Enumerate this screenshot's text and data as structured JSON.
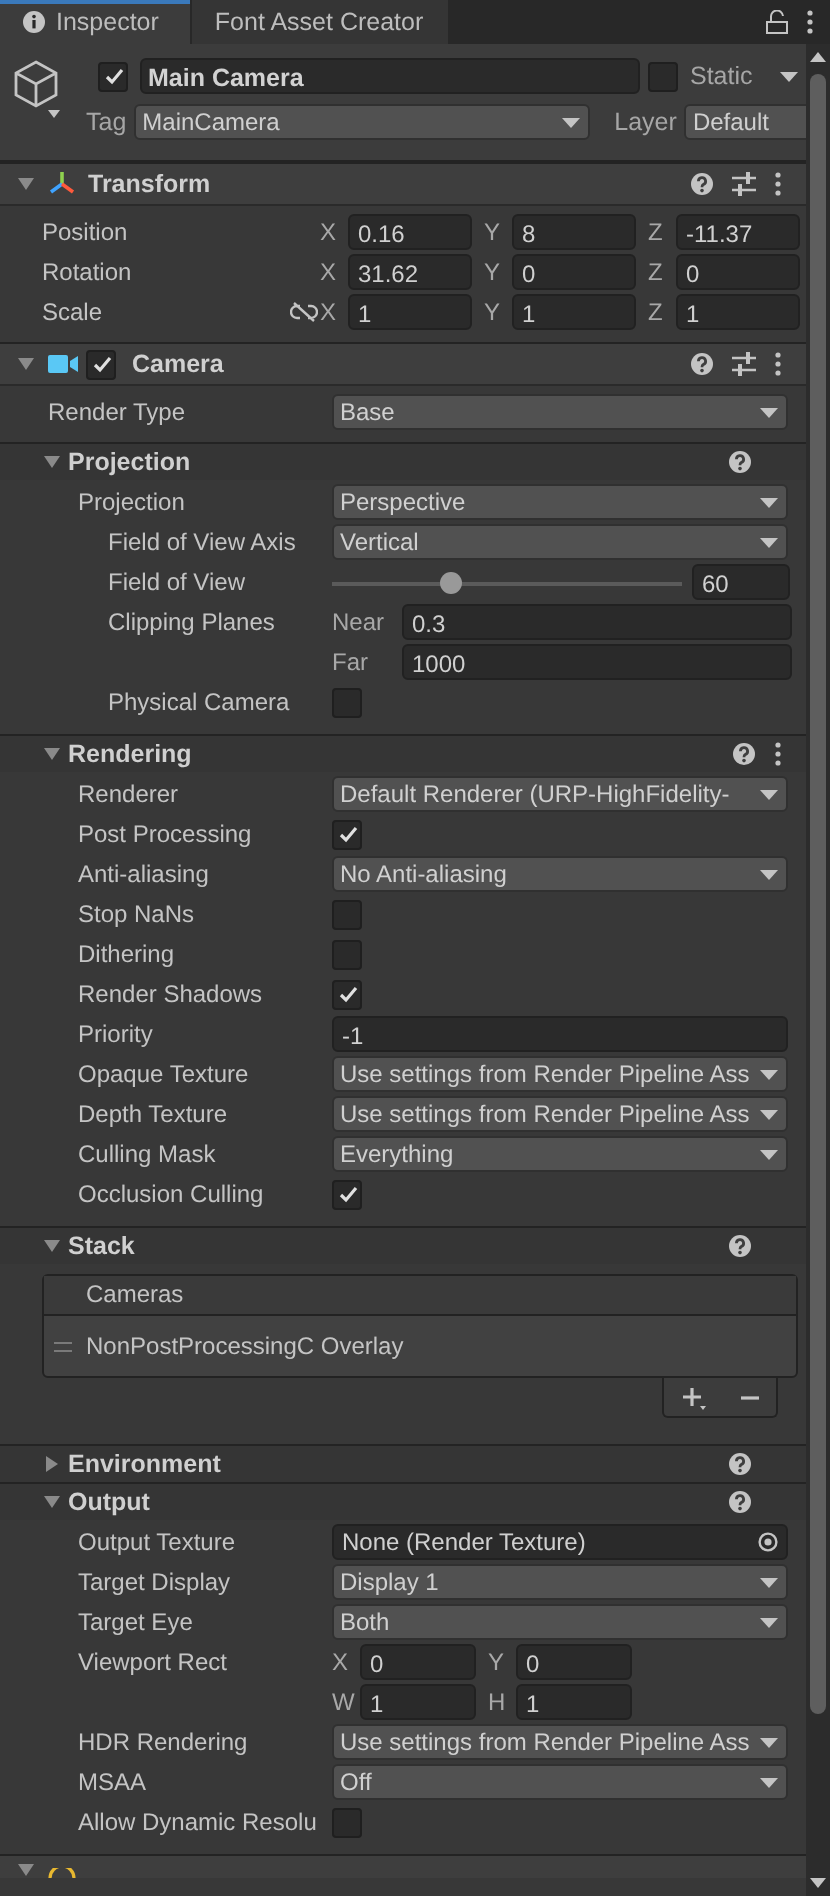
{
  "tabs": [
    {
      "label": "Inspector",
      "selected": true
    },
    {
      "label": "Font Asset Creator",
      "selected": false
    }
  ],
  "game_object": {
    "active": true,
    "name": "Main Camera",
    "static": false,
    "static_label": "Static",
    "tag_label": "Tag",
    "tag": "MainCamera",
    "layer_label": "Layer",
    "layer": "Default"
  },
  "components": [
    {
      "kind": "transform",
      "title": "Transform",
      "expanded": true,
      "help_button": true,
      "presets_button": true,
      "menu_button": true,
      "rows": [
        {
          "label": "Position",
          "kind": "vector",
          "fields": [
            {
              "axis": "X",
              "value": "0.16"
            },
            {
              "axis": "Y",
              "value": "8"
            },
            {
              "axis": "Z",
              "value": "-11.37"
            }
          ]
        },
        {
          "label": "Rotation",
          "kind": "vector",
          "fields": [
            {
              "axis": "X",
              "value": "31.62"
            },
            {
              "axis": "Y",
              "value": "0"
            },
            {
              "axis": "Z",
              "value": "0"
            }
          ]
        },
        {
          "label": "Scale",
          "kind": "vector",
          "proportions_linked": false,
          "fields": [
            {
              "axis": "X",
              "value": "1"
            },
            {
              "axis": "Y",
              "value": "1"
            },
            {
              "axis": "Z",
              "value": "1"
            }
          ]
        }
      ]
    },
    {
      "kind": "camera",
      "title": "Camera",
      "enabled": true,
      "expanded": true,
      "help_button": true,
      "presets_button": true,
      "menu_button": true,
      "rows": [
        {
          "label": "Render Type",
          "kind": "dropdown",
          "value": "Base"
        }
      ],
      "sections": [
        {
          "title": "Projection",
          "expanded": true,
          "help_button": true,
          "menu_button": false,
          "rows": [
            {
              "label": "Projection",
              "kind": "dropdown",
              "value": "Perspective",
              "children": [
                {
                  "label": "Field of View Axis",
                  "kind": "dropdown",
                  "value": "Vertical"
                },
                {
                  "label": "Field of View",
                  "kind": "slider",
                  "level": 0.335,
                  "value": "60"
                },
                {
                  "label": "Clipping Planes",
                  "kind": "pair",
                  "fields": [
                    {
                      "axis": "Near",
                      "value": "0.3"
                    },
                    {
                      "axis": "Far",
                      "value": "1000"
                    }
                  ]
                },
                {
                  "label": "Physical Camera",
                  "kind": "toggle",
                  "checked": false
                }
              ]
            }
          ]
        },
        {
          "title": "Rendering",
          "expanded": true,
          "help_button": true,
          "menu_button": true,
          "rows": [
            {
              "label": "Renderer",
              "kind": "dropdown",
              "value": "Default Renderer (URP-HighFidelity-"
            },
            {
              "label": "Post Processing",
              "kind": "toggle",
              "checked": true
            },
            {
              "label": "Anti-aliasing",
              "kind": "dropdown",
              "value": "No Anti-aliasing"
            },
            {
              "label": "Stop NaNs",
              "kind": "toggle",
              "checked": false
            },
            {
              "label": "Dithering",
              "kind": "toggle",
              "checked": false
            },
            {
              "label": "Render Shadows",
              "kind": "toggle",
              "checked": true
            },
            {
              "label": "Priority",
              "kind": "field",
              "value": "-1"
            },
            {
              "label": "Opaque Texture",
              "kind": "dropdown",
              "value": "Use settings from Render Pipeline Ass"
            },
            {
              "label": "Depth Texture",
              "kind": "dropdown",
              "value": "Use settings from Render Pipeline Ass"
            },
            {
              "label": "Culling Mask",
              "kind": "dropdown",
              "value": "Everything"
            },
            {
              "label": "Occlusion Culling",
              "kind": "toggle",
              "checked": true
            }
          ]
        },
        {
          "title": "Stack",
          "expanded": true,
          "help_button": true,
          "menu_button": false,
          "list": {
            "header": "Cameras",
            "items": [
              {
                "label": "NonPostProcessingC Overlay"
              }
            ]
          }
        },
        {
          "title": "Environment",
          "expanded": false,
          "help_button": true,
          "menu_button": false
        },
        {
          "title": "Output",
          "expanded": true,
          "help_button": true,
          "menu_button": false,
          "rows": [
            {
              "label": "Output Texture",
              "kind": "object",
              "value": "None (Render Texture)"
            },
            {
              "label": "Target Display",
              "kind": "dropdown",
              "value": "Display 1"
            },
            {
              "label": "Target Eye",
              "kind": "dropdown",
              "value": "Both"
            },
            {
              "label": "Viewport Rect",
              "kind": "rect",
              "fields": [
                {
                  "axis": "X",
                  "value": "0"
                },
                {
                  "axis": "Y",
                  "value": "0"
                },
                {
                  "axis": "W",
                  "value": "1"
                },
                {
                  "axis": "H",
                  "value": "1"
                }
              ]
            },
            {
              "label": "HDR Rendering",
              "kind": "dropdown",
              "value": "Use settings from Render Pipeline Ass"
            },
            {
              "label": "MSAA",
              "kind": "dropdown",
              "value": "Off"
            },
            {
              "label": "Allow Dynamic Resolu",
              "kind": "toggle",
              "checked": false
            }
          ]
        }
      ]
    },
    {
      "kind": "audio",
      "expanded": true,
      "cut": true
    }
  ]
}
